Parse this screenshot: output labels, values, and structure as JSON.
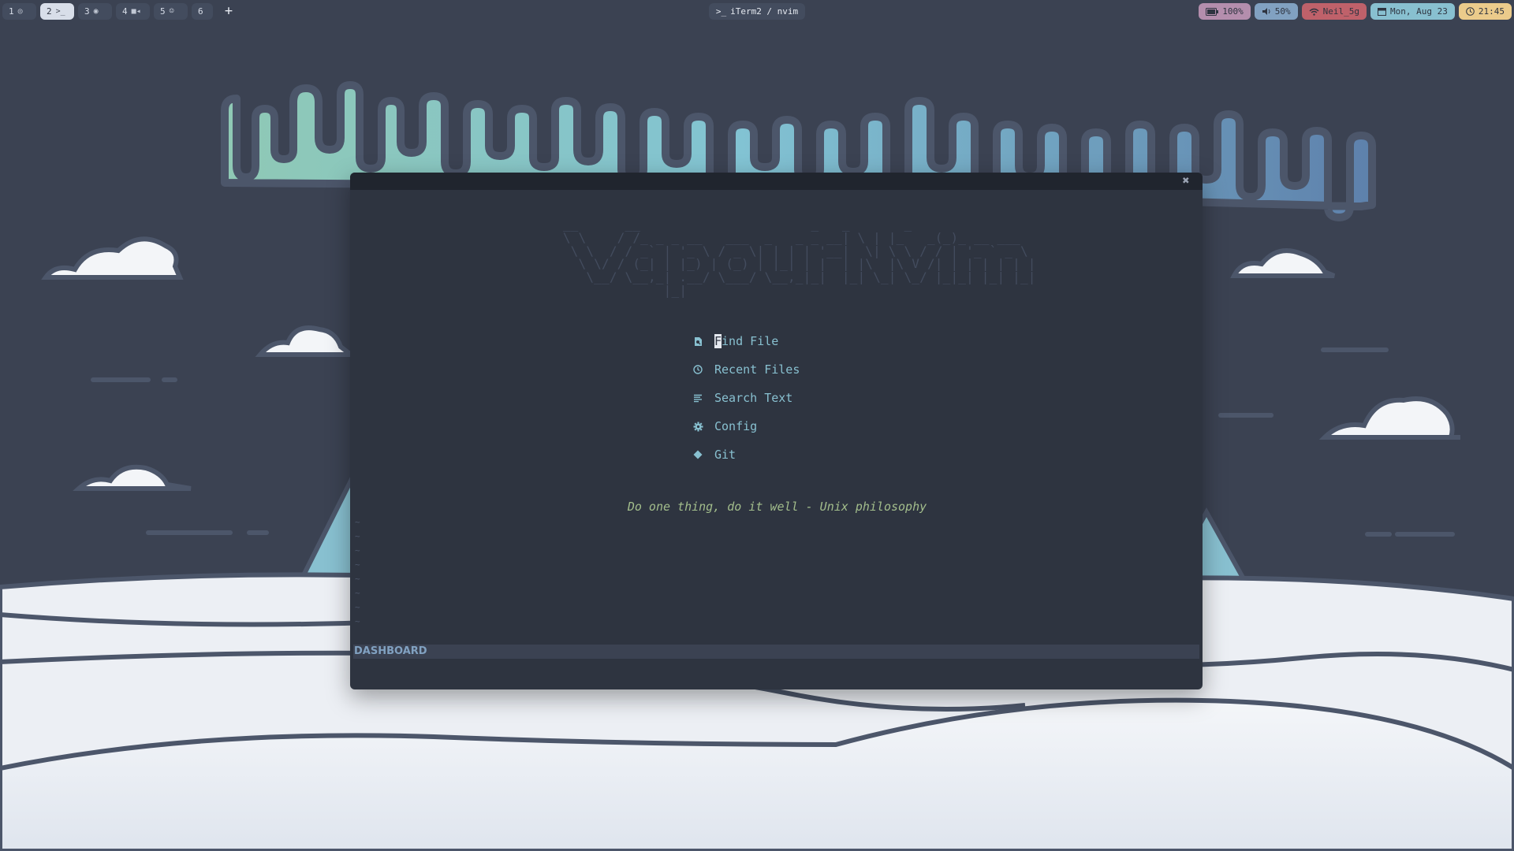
{
  "workspaces": [
    {
      "num": "1",
      "icon": "chrome-icon"
    },
    {
      "num": "2",
      "icon": "terminal-icon",
      "active": true
    },
    {
      "num": "3",
      "icon": "compass-icon"
    },
    {
      "num": "4",
      "icon": "video-icon"
    },
    {
      "num": "5",
      "icon": "discord-icon"
    },
    {
      "num": "6",
      "icon": ""
    }
  ],
  "ws_labels": {
    "w1": "1",
    "w2": "2",
    "w3": "3",
    "w4": "4",
    "w5": "5",
    "w6": "6",
    "add": "+"
  },
  "window_title": "iTerm2 / nvim",
  "status": {
    "battery": "100%",
    "volume": "50%",
    "wifi": "Neil_5g",
    "date": "Mon, Aug 23",
    "time": "21:45"
  },
  "colors": {
    "bar_bg": "#434c5e",
    "battery": "#b48ead",
    "volume": "#81a1c1",
    "wifi": "#bf616a",
    "date": "#88c0d0",
    "time": "#ebcb8b",
    "nvim_bg": "#2e3440",
    "accent": "#88c0d0",
    "quote": "#a3be8c"
  },
  "nvim": {
    "logo": " __      __                      _   _       _           \n \\ \\    / /_ _ _ __   ___  _   _ _ __| \\ | |_   _(_)_ __ ___  \n  \\ \\  / / _` | '_ \\ / _ \\| | | | '__|  \\| \\ \\ / / | '_ ` _ \\ \n   \\ \\/ / (_| | |_) | (_) | |_| | |  | |\\  |\\ V /| | | | | | |\n    \\__/ \\__,_| .__/ \\___/ \\__,_|_|  |_| \\_| \\_/ |_|_| |_| |_|\n              |_|                                              ",
    "menu": [
      {
        "first": "F",
        "rest": "ind File",
        "icon": "file-search-icon"
      },
      {
        "first": "",
        "rest": "Recent Files",
        "icon": "clock-icon"
      },
      {
        "first": "",
        "rest": "Search Text",
        "icon": "text-lines-icon"
      },
      {
        "first": "",
        "rest": "Config",
        "icon": "gear-icon"
      },
      {
        "first": "",
        "rest": "Git",
        "icon": "git-icon"
      }
    ],
    "quote": "Do one thing, do it well - Unix philosophy",
    "tildes": "~\n~\n~\n~\n~\n~\n~\n~",
    "statusline": "DASHBOARD"
  }
}
